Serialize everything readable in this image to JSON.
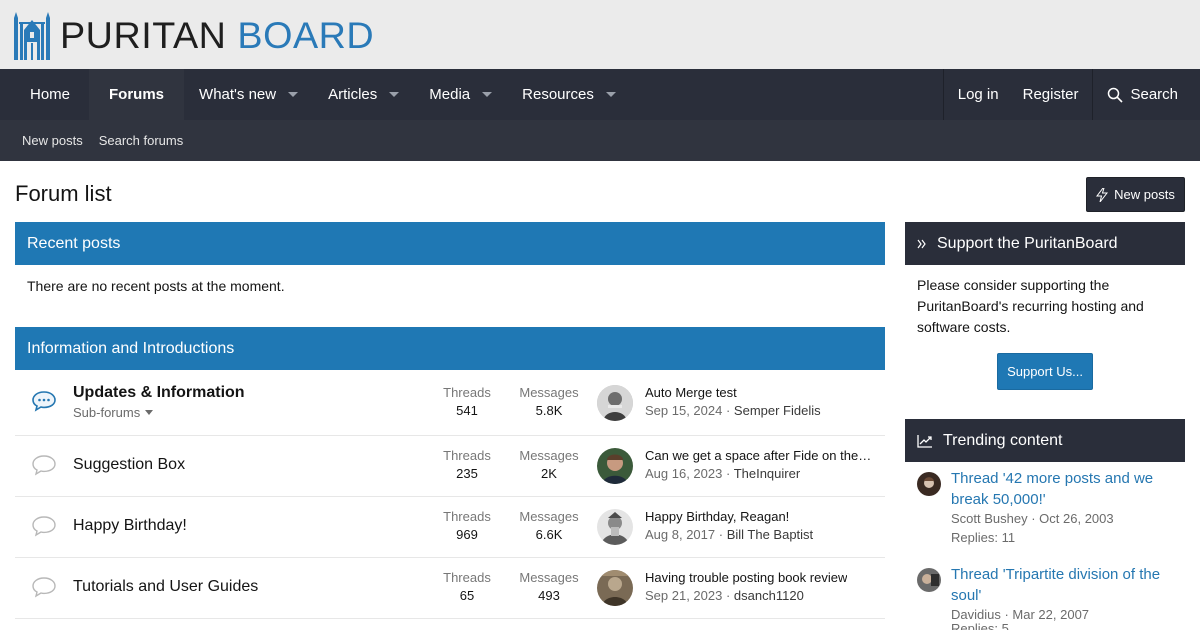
{
  "logo": {
    "part1": "PURITAN",
    "part2": "BOARD"
  },
  "nav": {
    "items": [
      {
        "label": "Home"
      },
      {
        "label": "Forums"
      },
      {
        "label": "What's new"
      },
      {
        "label": "Articles"
      },
      {
        "label": "Media"
      },
      {
        "label": "Resources"
      }
    ],
    "login": "Log in",
    "register": "Register",
    "search": "Search"
  },
  "subnav": {
    "new_posts": "New posts",
    "search_forums": "Search forums"
  },
  "main": {
    "title": "Forum list",
    "new_posts_button": "New posts",
    "recent_posts": {
      "heading": "Recent posts",
      "empty": "There are no recent posts at the moment."
    },
    "category": "Information and Introductions",
    "labels": {
      "threads": "Threads",
      "messages": "Messages"
    },
    "forums": [
      {
        "title": "Updates & Information",
        "subforums": "Sub-forums",
        "threads": "541",
        "messages": "5.8K",
        "last_title": "Auto Merge test",
        "last_date": "Sep 15, 2024",
        "last_user": "Semper Fidelis"
      },
      {
        "title": "Suggestion Box",
        "threads": "235",
        "messages": "2K",
        "last_title": "Can we get a space after Fide on the homepage?",
        "last_date": "Aug 16, 2023",
        "last_user": "TheInquirer"
      },
      {
        "title": "Happy Birthday!",
        "threads": "969",
        "messages": "6.6K",
        "last_title": "Happy Birthday, Reagan!",
        "last_date": "Aug 8, 2017",
        "last_user": "Bill The Baptist"
      },
      {
        "title": "Tutorials and User Guides",
        "threads": "65",
        "messages": "493",
        "last_title": "Having trouble posting book review",
        "last_date": "Sep 21, 2023",
        "last_user": "dsanch1120"
      }
    ]
  },
  "sidebar": {
    "support": {
      "heading": "Support the PuritanBoard",
      "text": "Please consider supporting the PuritanBoard's recurring hosting and software costs.",
      "button": "Support Us..."
    },
    "trending": {
      "heading": "Trending content",
      "items": [
        {
          "title": "Thread '42 more posts and we break 50,000!'",
          "user": "Scott Bushey",
          "date": "Oct 26, 2003",
          "replies": "Replies: 11"
        },
        {
          "title": "Thread 'Tripartite division of the soul'",
          "user": "Davidius",
          "date": "Mar 22, 2007",
          "replies": "Replies: 5"
        }
      ]
    }
  },
  "colors": {
    "accent": "#1f78b4",
    "nav": "#2a2e3a",
    "header": "#ebebeb",
    "link": "#2577b1"
  }
}
